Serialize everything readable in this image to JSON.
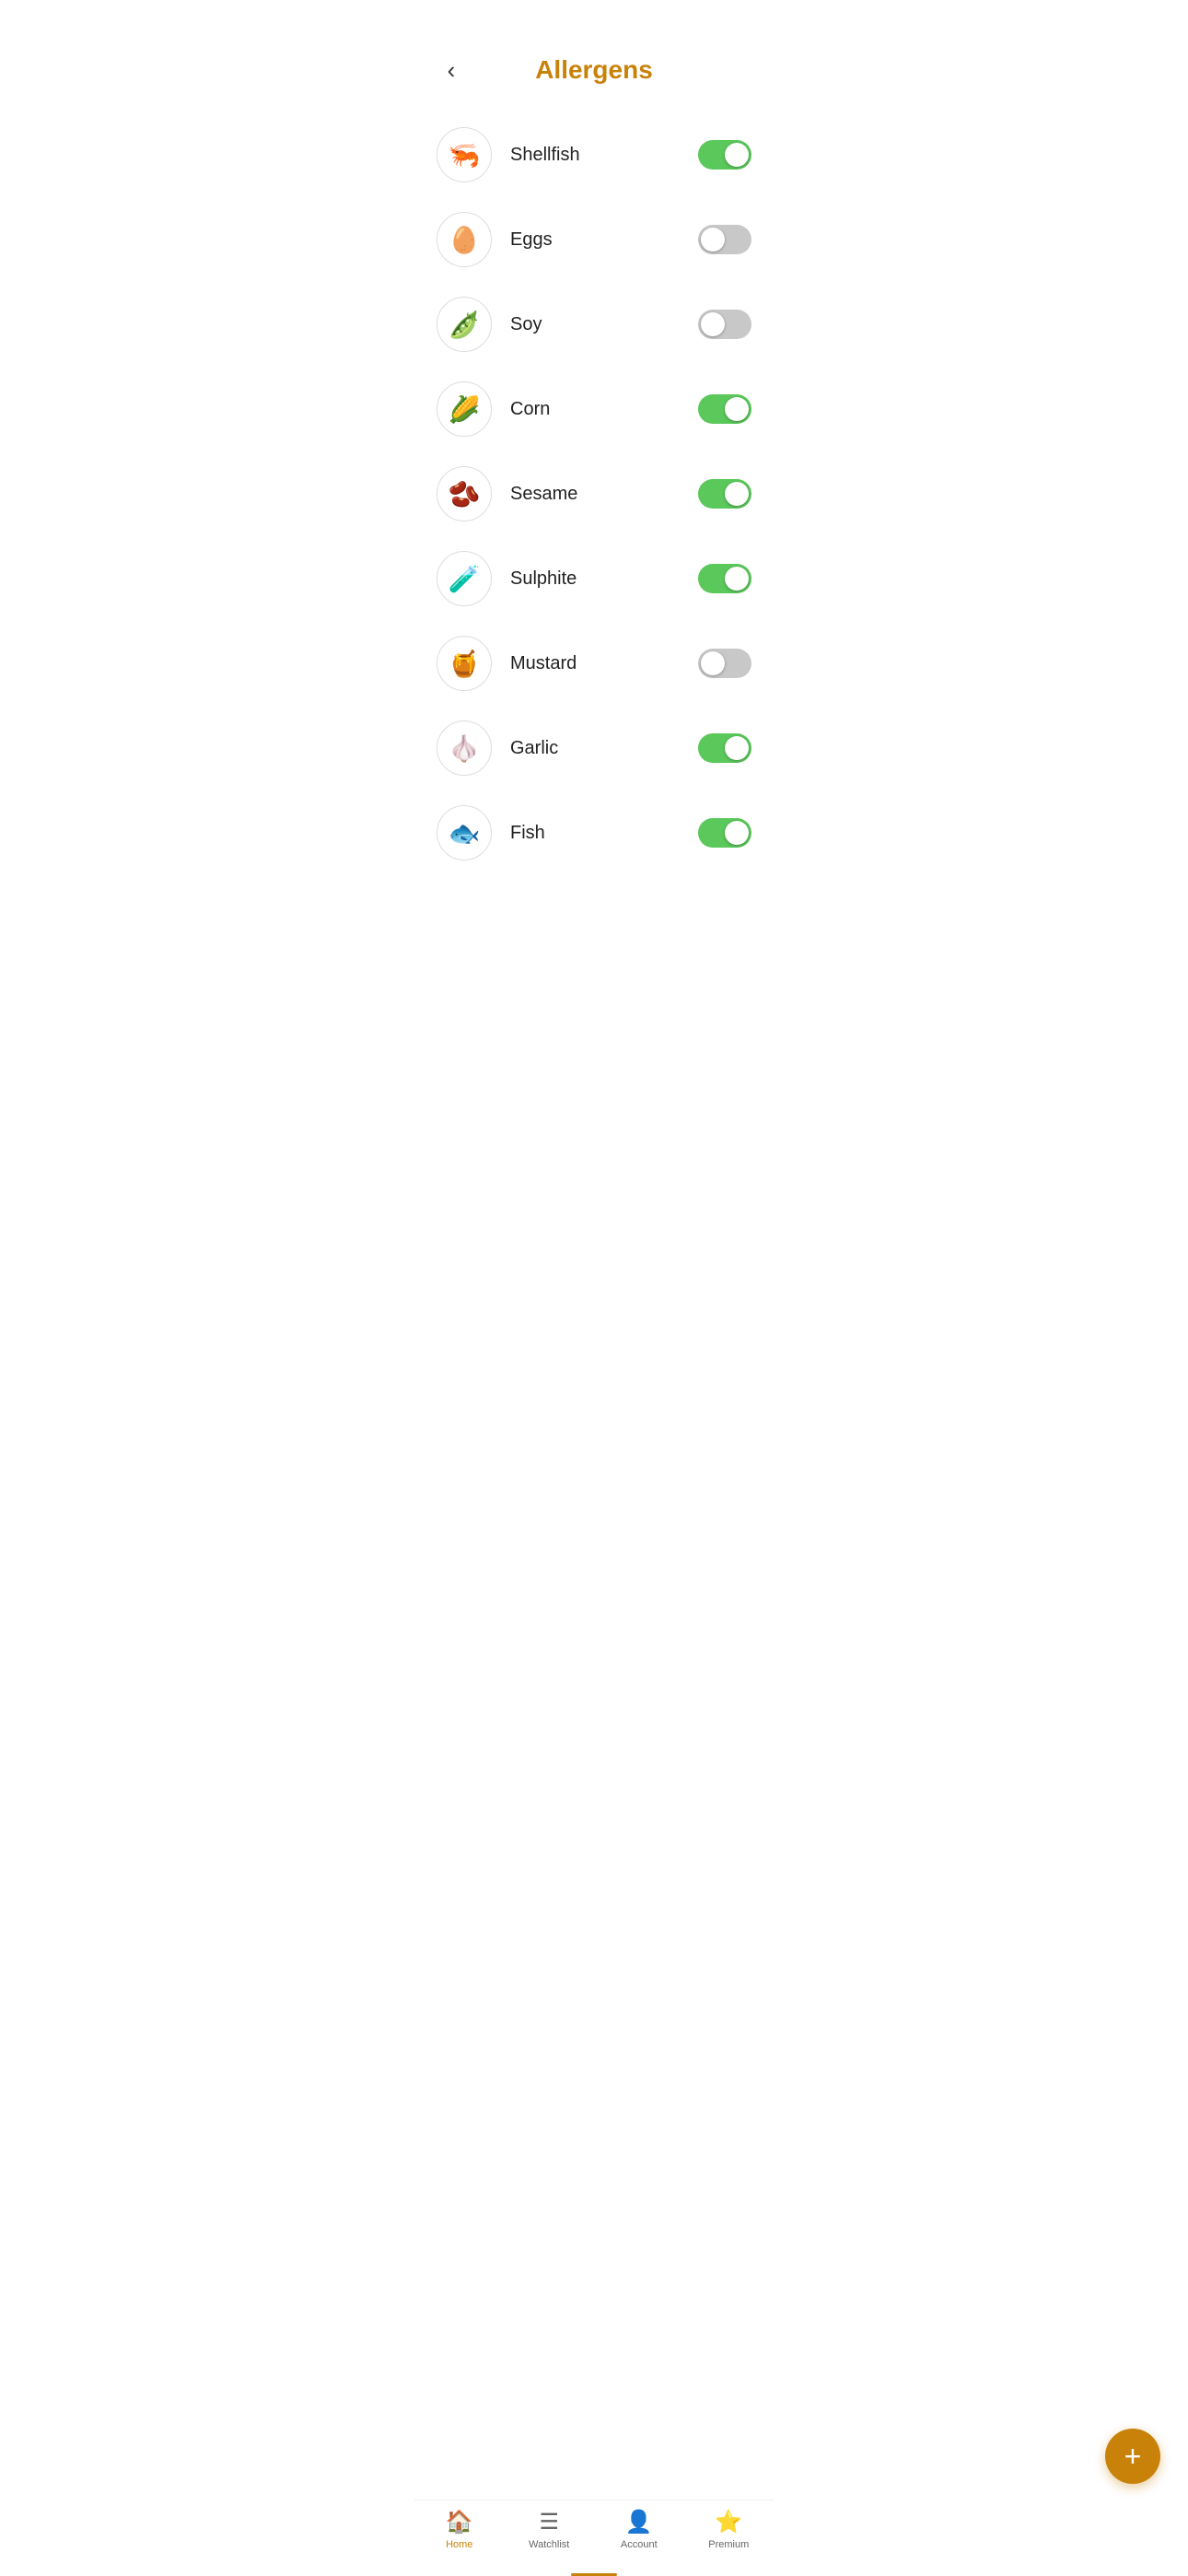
{
  "header": {
    "title": "Allergens",
    "back_label": "‹"
  },
  "allergens": [
    {
      "id": "shellfish",
      "label": "Shellfish",
      "icon": "🦐",
      "enabled": true
    },
    {
      "id": "eggs",
      "label": "Eggs",
      "icon": "🥚",
      "enabled": false
    },
    {
      "id": "soy",
      "label": "Soy",
      "icon": "🫛",
      "enabled": false
    },
    {
      "id": "corn",
      "label": "Corn",
      "icon": "🌽",
      "enabled": true
    },
    {
      "id": "sesame",
      "label": "Sesame",
      "icon": "🫘",
      "enabled": true
    },
    {
      "id": "sulphite",
      "label": "Sulphite",
      "icon": "🧪",
      "enabled": true
    },
    {
      "id": "mustard",
      "label": "Mustard",
      "icon": "🍯",
      "enabled": false
    },
    {
      "id": "garlic",
      "label": "Garlic",
      "icon": "🧄",
      "enabled": true
    },
    {
      "id": "fish",
      "label": "Fish",
      "icon": "🐟",
      "enabled": true
    }
  ],
  "fab": {
    "label": "+"
  },
  "nav": {
    "items": [
      {
        "id": "home",
        "label": "Home",
        "icon": "🏠",
        "active": true
      },
      {
        "id": "watchlist",
        "label": "Watchlist",
        "icon": "☰",
        "active": false
      },
      {
        "id": "account",
        "label": "Account",
        "icon": "👤",
        "active": false
      },
      {
        "id": "premium",
        "label": "Premium",
        "icon": "⭐",
        "active": false
      }
    ]
  },
  "colors": {
    "accent": "#C8820A",
    "toggle_on": "#5AC85A",
    "toggle_off": "#c8c8c8"
  }
}
